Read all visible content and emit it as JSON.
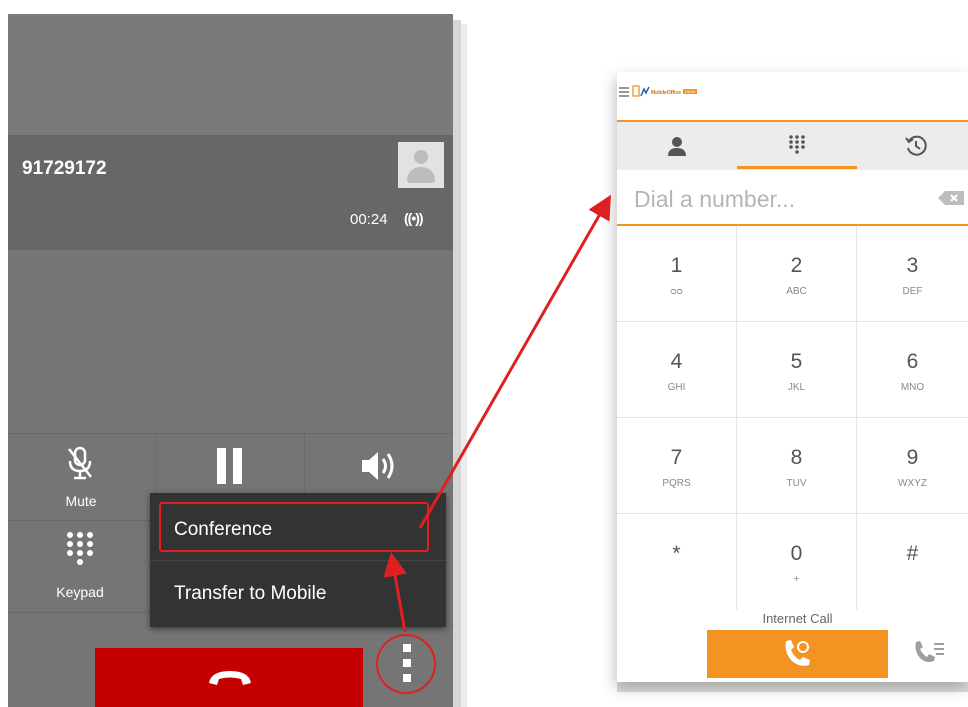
{
  "left_call_screen": {
    "caller_number": "91729172",
    "call_timer": "00:24",
    "signal_indicator": "((•))",
    "controls": {
      "mute_label": "Mute",
      "keypad_label": "Keypad"
    },
    "overflow_menu": {
      "items": [
        "Conference",
        "Transfer to Mobile"
      ]
    },
    "colors": {
      "end_call": "#c40000",
      "annotation_red": "#e02020"
    }
  },
  "dialer_app": {
    "logo_text": "MobileOffice",
    "logo_badge": "DATA",
    "tabs": [
      "contacts-icon",
      "dialpad-icon",
      "recents-icon"
    ],
    "active_tab": 1,
    "dial_placeholder": "Dial a number...",
    "keys": [
      {
        "digit": "1",
        "letters": "ᴑᴑ"
      },
      {
        "digit": "2",
        "letters": "ABC"
      },
      {
        "digit": "3",
        "letters": "DEF"
      },
      {
        "digit": "4",
        "letters": "GHI"
      },
      {
        "digit": "5",
        "letters": "JKL"
      },
      {
        "digit": "6",
        "letters": "MNO"
      },
      {
        "digit": "7",
        "letters": "PQRS"
      },
      {
        "digit": "8",
        "letters": "TUV"
      },
      {
        "digit": "9",
        "letters": "WXYZ"
      },
      {
        "digit": "*",
        "letters": ""
      },
      {
        "digit": "0",
        "letters": "+"
      },
      {
        "digit": "#",
        "letters": ""
      }
    ],
    "internet_call_label": "Internet Call",
    "colors": {
      "accent": "#f39422"
    }
  }
}
